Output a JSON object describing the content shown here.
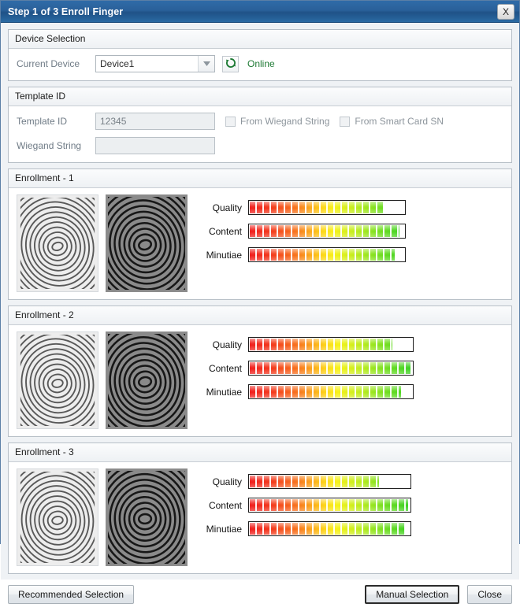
{
  "window": {
    "title": "Step 1 of 3 Enroll Finger",
    "close_label": "X"
  },
  "device_selection": {
    "group_title": "Device Selection",
    "current_device_label": "Current Device",
    "device_value": "Device1",
    "refresh_icon": "refresh-icon",
    "status": "Online",
    "status_color": "#1e7a34"
  },
  "template_id": {
    "group_title": "Template ID",
    "template_id_label": "Template ID",
    "template_id_value": "12345",
    "wiegand_label": "Wiegand String",
    "wiegand_value": "",
    "from_wiegand_label": "From Wiegand String",
    "from_wiegand_checked": false,
    "from_smartcard_label": "From Smart Card SN",
    "from_smartcard_checked": false
  },
  "enrollments": [
    {
      "title": "Enrollment - 1",
      "meters": [
        {
          "label": "Quality",
          "percent": 86
        },
        {
          "label": "Content",
          "percent": 97
        },
        {
          "label": "Minutiae",
          "percent": 94
        }
      ]
    },
    {
      "title": "Enrollment - 2",
      "meters": [
        {
          "label": "Quality",
          "percent": 88
        },
        {
          "label": "Content",
          "percent": 99
        },
        {
          "label": "Minutiae",
          "percent": 93
        }
      ]
    },
    {
      "title": "Enrollment - 3",
      "meters": [
        {
          "label": "Quality",
          "percent": 81
        },
        {
          "label": "Content",
          "percent": 99
        },
        {
          "label": "Minutiae",
          "percent": 97
        }
      ]
    }
  ],
  "meter_track_widths": [
    200,
    210,
    207
  ],
  "footer": {
    "recommended_label": "Recommended Selection",
    "manual_label": "Manual Selection",
    "close_label": "Close",
    "focused_button": "manual"
  },
  "colors": {
    "titlebar": "#2a6099",
    "meter_low": "#f01d1d",
    "meter_mid": "#f7f217",
    "meter_high": "#34cf24"
  }
}
